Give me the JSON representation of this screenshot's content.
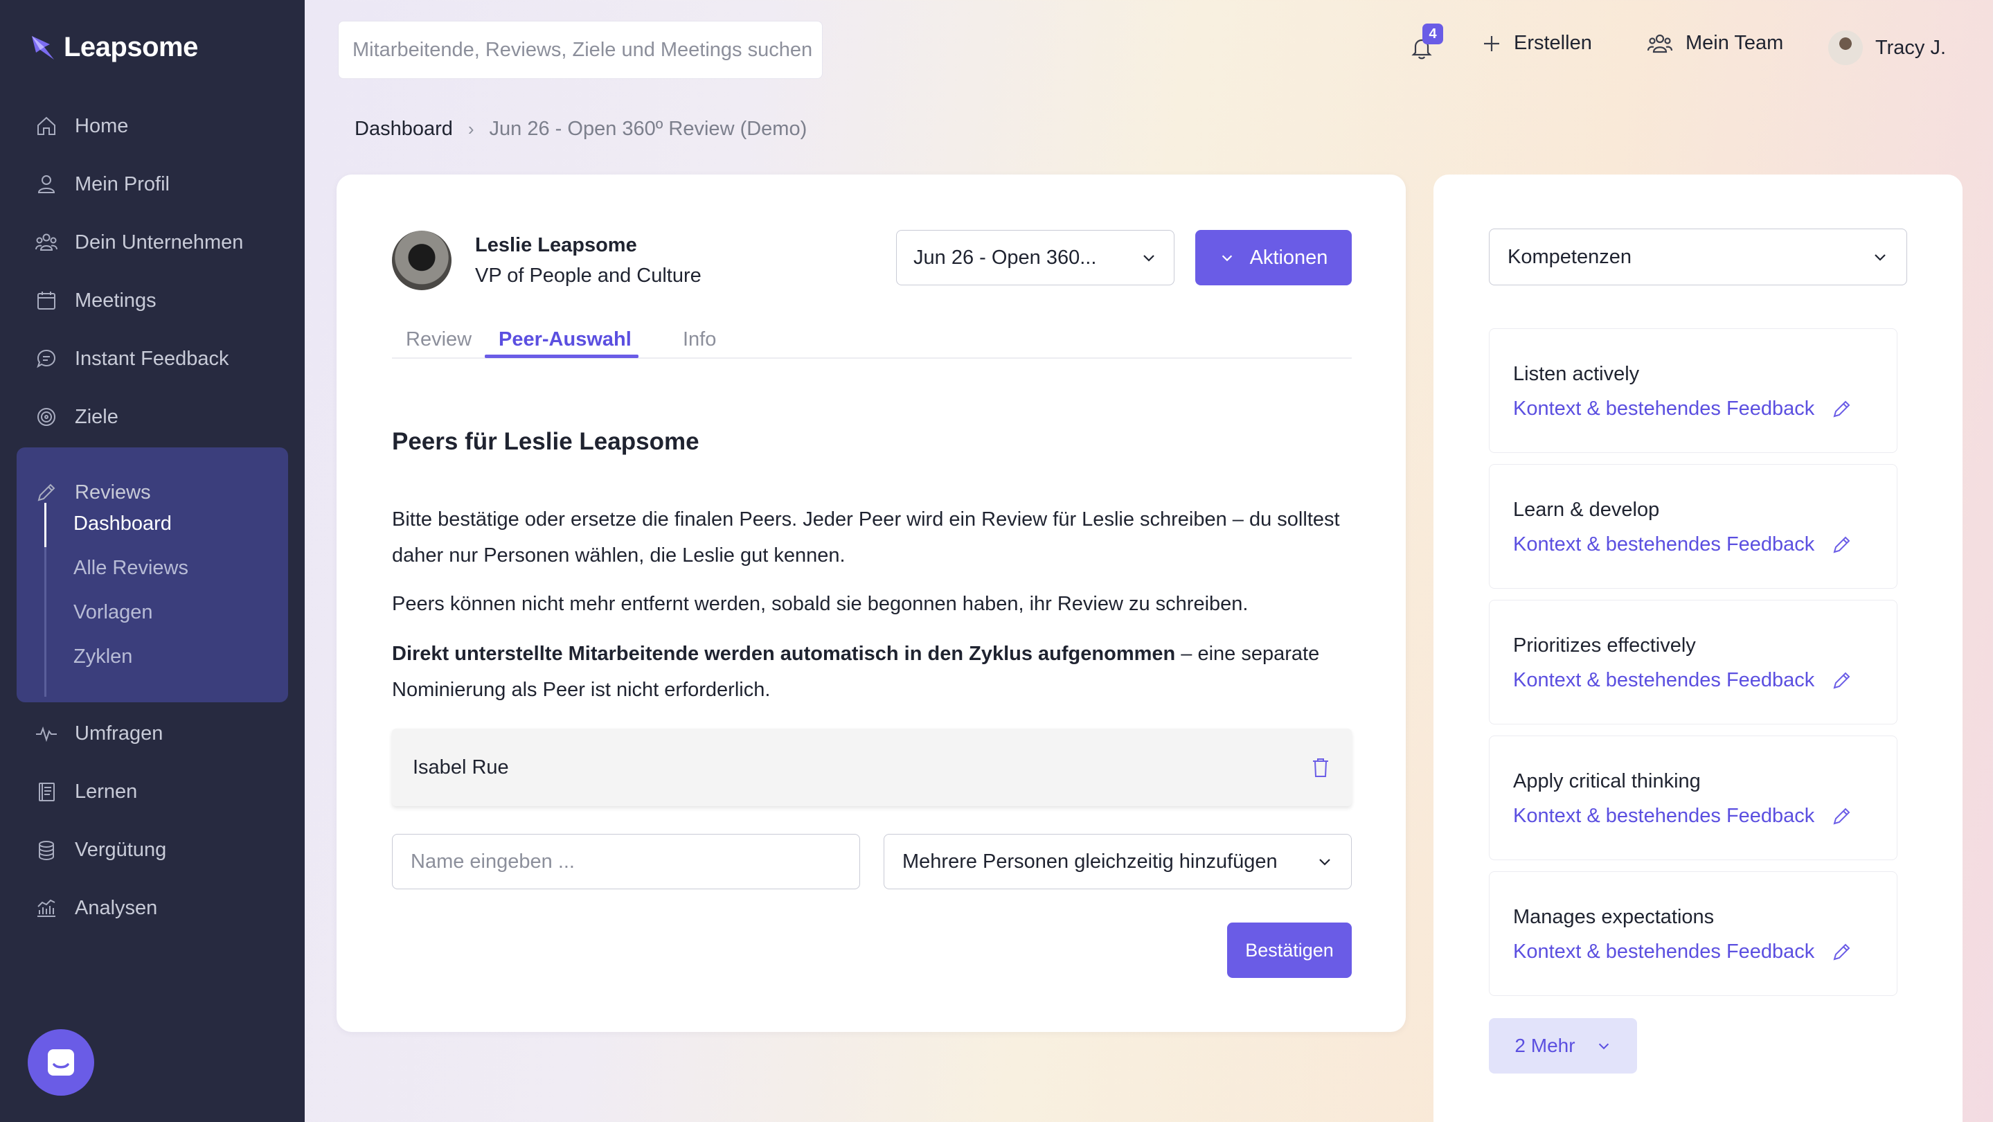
{
  "app": {
    "brand": "Leapsome"
  },
  "sidebar": {
    "items": [
      {
        "label": "Home",
        "icon": "home-icon"
      },
      {
        "label": "Mein Profil",
        "icon": "user-icon"
      },
      {
        "label": "Dein Unternehmen",
        "icon": "users-icon"
      },
      {
        "label": "Meetings",
        "icon": "calendar-icon"
      },
      {
        "label": "Instant Feedback",
        "icon": "chat-icon"
      },
      {
        "label": "Ziele",
        "icon": "target-icon"
      },
      {
        "label": "Reviews",
        "icon": "pencil-icon"
      },
      {
        "label": "Umfragen",
        "icon": "pulse-icon"
      },
      {
        "label": "Lernen",
        "icon": "book-icon"
      },
      {
        "label": "Vergütung",
        "icon": "coins-icon"
      },
      {
        "label": "Analysen",
        "icon": "analytics-icon"
      }
    ],
    "reviews_sub": [
      {
        "label": "Dashboard",
        "active": true
      },
      {
        "label": "Alle Reviews"
      },
      {
        "label": "Vorlagen"
      },
      {
        "label": "Zyklen"
      }
    ]
  },
  "topbar": {
    "search_placeholder": "Mitarbeitende, Reviews, Ziele und Meetings suchen",
    "notification_count": "4",
    "create_label": "Erstellen",
    "team_label": "Mein Team",
    "user_name": "Tracy J."
  },
  "breadcrumb": {
    "root": "Dashboard",
    "current": "Jun 26 - Open 360º Review (Demo)"
  },
  "main": {
    "person_name": "Leslie Leapsome",
    "person_role": "VP of People and Culture",
    "cycle_selected": "Jun 26 - Open 360...",
    "actions_label": "Aktionen",
    "tabs": [
      {
        "label": "Review"
      },
      {
        "label": "Peer-Auswahl",
        "active": true
      },
      {
        "label": "Info"
      }
    ],
    "section_title": "Peers für Leslie Leapsome",
    "para1": "Bitte bestätige oder ersetze die finalen Peers. Jeder Peer wird ein Review für Leslie schreiben – du solltest daher nur Personen wählen, die Leslie gut kennen.",
    "para2": "Peers können nicht mehr entfernt werden, sobald sie begonnen haben, ihr Review zu schreiben.",
    "para3_bold": "Direkt unterstellte Mitarbeitende werden automatisch in den Zyklus aufgenommen",
    "para3_rest": " – eine separate Nominierung als Peer ist nicht erforderlich.",
    "peers": [
      {
        "name": "Isabel Rue"
      }
    ],
    "name_placeholder": "Name eingeben ...",
    "multi_add_label": "Mehrere Personen gleichzeitig hinzufügen",
    "confirm_label": "Bestätigen"
  },
  "right_panel": {
    "select_label": "Kompetenzen",
    "link_label": "Kontext & bestehendes Feedback",
    "competencies": [
      {
        "title": "Listen actively"
      },
      {
        "title": "Learn & develop"
      },
      {
        "title": "Prioritizes effectively"
      },
      {
        "title": "Apply critical thinking"
      },
      {
        "title": "Manages expectations"
      }
    ],
    "more_label": "2 Mehr"
  },
  "colors": {
    "accent": "#6a5ce6",
    "sidebar_bg": "#272a40",
    "sidebar_active_bg": "#3b3e7c"
  }
}
